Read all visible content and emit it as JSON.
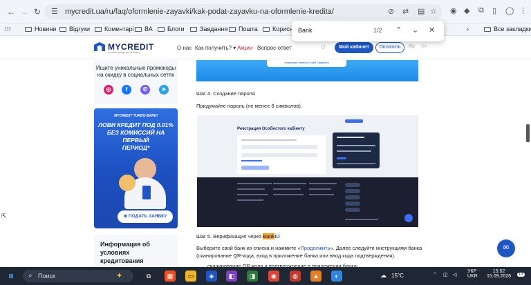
{
  "browser": {
    "url": "mycredit.ua/ru/faq/oformlenie-zayavki/kak-podat-zayavku-na-oformlenie-kredita/",
    "bookmarks": [
      "Новини",
      "Відгуки",
      "Коментарі",
      "ВА",
      "Блоги",
      "Завдання",
      "Пошта",
      "Корисні"
    ],
    "all_bookmarks": "Все закладки",
    "find": {
      "term": "Bank",
      "count": "1/2"
    }
  },
  "site": {
    "logo": "MYCREDIT",
    "logo_tag": "онлайн кредиты на карту",
    "nav": [
      "О нас",
      "Как получить?",
      "Акции",
      "Вопрос-ответ"
    ],
    "cabinet": "Мой кабинет",
    "pay": "Оплатить",
    "lang": [
      "RU",
      "UA"
    ],
    "accent": "#1f56c4",
    "promo_color": "#e0243a"
  },
  "sidebar": {
    "promo_text": [
      "Ищите уникальные промокоды",
      "на скидку в социальных сетях"
    ],
    "banner_small": "MYCREDIT TURBO-BANKI",
    "banner_big": [
      "ЛОВИ КРЕДИТ ПОД 0.01%",
      "БЕЗ КОМИССИЙ НА ПЕРВЫЙ",
      "ПЕРИОД*"
    ],
    "banner_cta": "ПОДАТЬ ЗАЯВКУ",
    "info_title": [
      "Информация об",
      "условиях",
      "кредитования"
    ]
  },
  "article": {
    "top_card": "Надёжная замена Стрёй-Трудбета",
    "step4": "Шаг 4. Создание пароля",
    "password_text": "Придумайте пароль (не менее 8 символов).",
    "shot_title": "Рекстрация Особистого кабінету",
    "step5_before": "Шаг 5. Верификация через ",
    "step5_hl": "Bank",
    "step5_after": "ID",
    "choose_before": "Выберите свой банк из списка и нажмите «",
    "choose_link": "Продолжить",
    "choose_after": "». Далее следуйте инструкциям банка",
    "choose_line2": "(сканирование QR-кода, вход в приложение банка или ввод кода подтверждения).",
    "bullet": "сканирование QR-кода и подтверждение в приложении банка;"
  },
  "taskbar": {
    "search": "Поиск",
    "temp": "15°C",
    "lang": [
      "УКР",
      "UKR"
    ],
    "time": "15:52",
    "date": "15.09.2026",
    "notif": "13"
  }
}
